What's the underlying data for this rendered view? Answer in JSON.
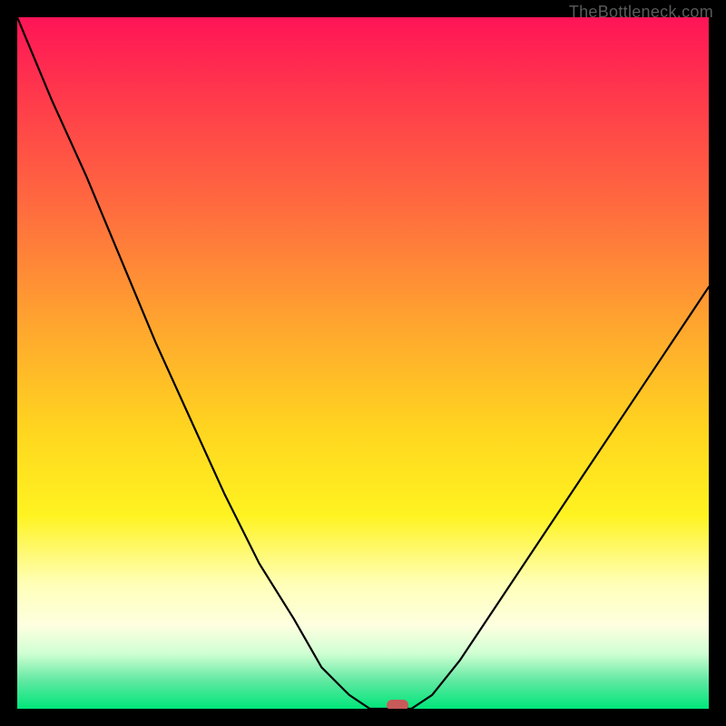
{
  "watermark": "TheBottleneck.com",
  "chart_data": {
    "type": "line",
    "title": "",
    "xlabel": "",
    "ylabel": "",
    "x": [
      0.0,
      0.05,
      0.1,
      0.15,
      0.2,
      0.25,
      0.3,
      0.35,
      0.4,
      0.44,
      0.48,
      0.51,
      0.54,
      0.57,
      0.6,
      0.64,
      0.7,
      0.76,
      0.82,
      0.88,
      0.94,
      1.0
    ],
    "values": [
      1.0,
      0.88,
      0.77,
      0.65,
      0.53,
      0.42,
      0.31,
      0.21,
      0.13,
      0.06,
      0.02,
      0.0,
      0.0,
      0.0,
      0.02,
      0.07,
      0.16,
      0.25,
      0.34,
      0.43,
      0.52,
      0.61
    ],
    "xlim": [
      0,
      1
    ],
    "ylim": [
      0,
      1
    ],
    "minimum": {
      "x": 0.55,
      "y": 0.0
    },
    "background_gradient": {
      "stops": [
        {
          "pos": 0.0,
          "color": "#ff1457"
        },
        {
          "pos": 0.12,
          "color": "#ff3b4b"
        },
        {
          "pos": 0.28,
          "color": "#ff6d3e"
        },
        {
          "pos": 0.45,
          "color": "#ffa72e"
        },
        {
          "pos": 0.6,
          "color": "#ffd61f"
        },
        {
          "pos": 0.72,
          "color": "#fff321"
        },
        {
          "pos": 0.82,
          "color": "#ffffb8"
        },
        {
          "pos": 0.88,
          "color": "#fdffe0"
        },
        {
          "pos": 0.92,
          "color": "#d0ffd3"
        },
        {
          "pos": 0.96,
          "color": "#5fe8a1"
        },
        {
          "pos": 1.0,
          "color": "#00e67a"
        }
      ]
    },
    "marker_color": "#c85a5a",
    "line_color": "#000000"
  }
}
